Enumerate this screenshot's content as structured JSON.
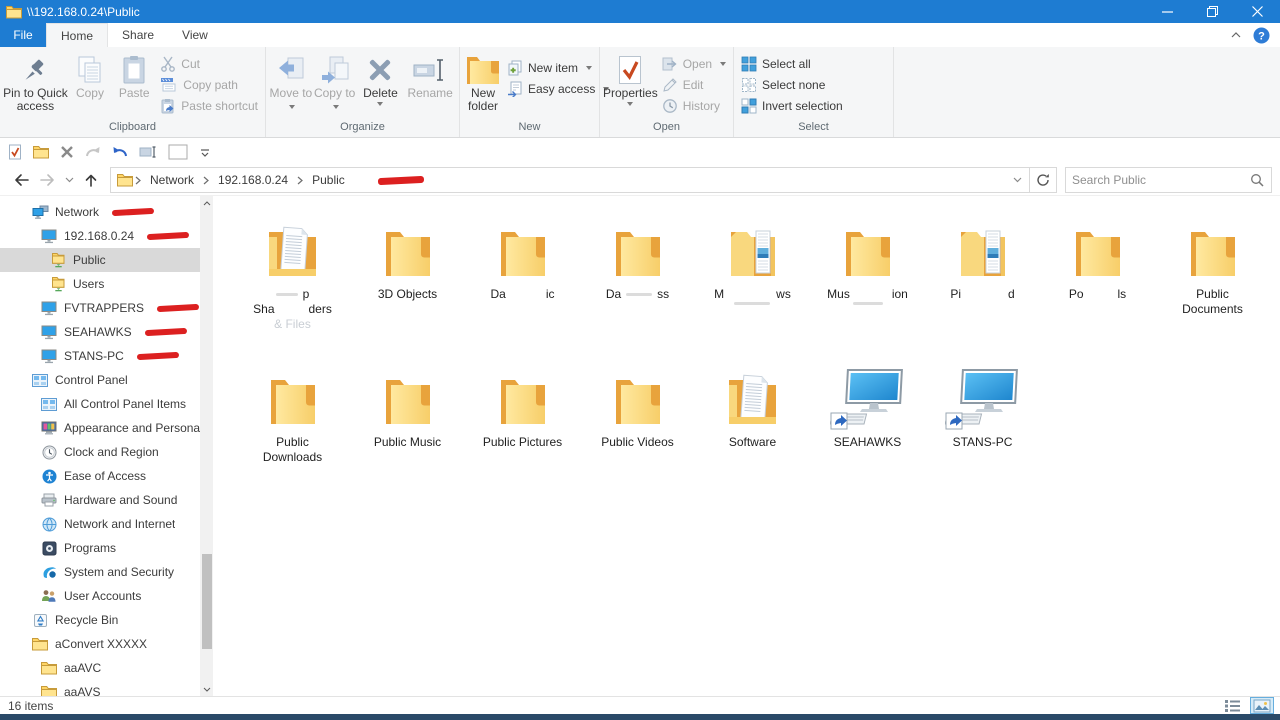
{
  "window": {
    "title": "\\\\192.168.0.24\\Public"
  },
  "tabs": {
    "file": "File",
    "home": "Home",
    "share": "Share",
    "view": "View"
  },
  "ribbon": {
    "clipboard": {
      "group": "Clipboard",
      "pin": "Pin to Quick access",
      "copy": "Copy",
      "paste": "Paste",
      "cut": "Cut",
      "copy_path": "Copy path",
      "paste_shortcut": "Paste shortcut"
    },
    "organize": {
      "group": "Organize",
      "move_to": "Move to",
      "copy_to": "Copy to",
      "delete": "Delete",
      "rename": "Rename"
    },
    "new": {
      "group": "New",
      "new_folder": "New folder",
      "new_item": "New item",
      "easy_access": "Easy access"
    },
    "open": {
      "group": "Open",
      "properties": "Properties",
      "open": "Open",
      "edit": "Edit",
      "history": "History"
    },
    "select": {
      "group": "Select",
      "select_all": "Select all",
      "select_none": "Select none",
      "invert": "Invert selection"
    }
  },
  "qat": {
    "items": [
      {
        "name": "properties",
        "icon": "qat-props"
      },
      {
        "name": "new-folder",
        "icon": "folder-sm"
      },
      {
        "name": "delete",
        "icon": "qat-x"
      },
      {
        "name": "redo",
        "icon": "qat-redo"
      },
      {
        "name": "undo",
        "icon": "qat-undo"
      },
      {
        "name": "rename",
        "icon": "qat-rename"
      },
      {
        "name": "blank",
        "icon": "qat-box"
      },
      {
        "name": "customize",
        "icon": "qat-more"
      }
    ]
  },
  "address": {
    "crumbs": [
      "Network",
      "192.168.0.24",
      "Public"
    ],
    "search_placeholder": "Search Public"
  },
  "sidebar": {
    "items": [
      {
        "label": "Network",
        "icon": "network",
        "indent": 0,
        "scribble": true
      },
      {
        "label": "192.168.0.24",
        "icon": "monitor",
        "indent": 1,
        "scribble": true
      },
      {
        "label": "Public",
        "icon": "sharedfolder",
        "indent": 2,
        "selected": true
      },
      {
        "label": "Users",
        "icon": "sharedfolder",
        "indent": 2
      },
      {
        "label": "FVTRAPPERS",
        "icon": "monitor",
        "indent": 1,
        "scribble": true
      },
      {
        "label": "SEAHAWKS",
        "icon": "monitor",
        "indent": 1,
        "scribble": true
      },
      {
        "label": "STANS-PC",
        "icon": "monitor",
        "indent": 1,
        "scribble": true
      },
      {
        "label": "Control Panel",
        "icon": "controlpanel",
        "indent": 0
      },
      {
        "label": "All Control Panel Items",
        "icon": "controlpanel",
        "indent": 1
      },
      {
        "label": "Appearance and Personalization",
        "icon": "appearance",
        "indent": 1
      },
      {
        "label": "Clock and Region",
        "icon": "clock",
        "indent": 1
      },
      {
        "label": "Ease of Access",
        "icon": "ease",
        "indent": 1
      },
      {
        "label": "Hardware and Sound",
        "icon": "hardware",
        "indent": 1
      },
      {
        "label": "Network and Internet",
        "icon": "netinternet",
        "indent": 1
      },
      {
        "label": "Programs",
        "icon": "programs",
        "indent": 1
      },
      {
        "label": "System and Security",
        "icon": "security",
        "indent": 1
      },
      {
        "label": "User Accounts",
        "icon": "users",
        "indent": 1
      },
      {
        "label": "Recycle Bin",
        "icon": "recycle",
        "indent": 0
      },
      {
        "label": "aConvert XXXXX",
        "icon": "folder",
        "indent": 0
      },
      {
        "label": "aaAVC",
        "icon": "folder",
        "indent": 1
      },
      {
        "label": "aaAVS",
        "icon": "folder",
        "indent": 1
      }
    ]
  },
  "files": {
    "items": [
      {
        "name": "shared-folders",
        "icon": "folder-doc",
        "lines": [
          [
            {
              "smudge": 22
            },
            {
              "gap": 5
            },
            {
              "t": "p"
            }
          ],
          [
            {
              "t": "Sha"
            },
            {
              "gap": 34
            },
            {
              "t": "ders"
            }
          ],
          [
            {
              "t": "& Files",
              "faint": true
            }
          ]
        ]
      },
      {
        "name": "3d-objects",
        "icon": "folder",
        "lines": [
          [
            {
              "t": "3D Objects"
            }
          ]
        ]
      },
      {
        "name": "redacted-da-ic",
        "icon": "folder",
        "lines": [
          [
            {
              "t": "Da"
            },
            {
              "gap": 40
            },
            {
              "t": "ic"
            }
          ]
        ]
      },
      {
        "name": "redacted-da-ss",
        "icon": "folder",
        "lines": [
          [
            {
              "t": "Da"
            },
            {
              "gap": 5
            },
            {
              "smudge": 26
            },
            {
              "gap": 5
            },
            {
              "t": "ss"
            }
          ]
        ]
      },
      {
        "name": "redacted-m-ws",
        "icon": "folder-files",
        "lines": [
          [
            {
              "t": "M"
            },
            {
              "gap": 52
            },
            {
              "t": "ws"
            }
          ],
          [
            {
              "smudge": 36
            }
          ]
        ]
      },
      {
        "name": "redacted-mus-ion",
        "icon": "folder",
        "lines": [
          [
            {
              "t": "Mus"
            },
            {
              "gap": 42
            },
            {
              "t": "ion"
            }
          ],
          [
            {
              "smudge": 30
            }
          ]
        ]
      },
      {
        "name": "redacted-pi-d",
        "icon": "folder-files",
        "lines": [
          [
            {
              "t": "Pi"
            },
            {
              "gap": 47
            },
            {
              "t": "d"
            }
          ]
        ]
      },
      {
        "name": "redacted-po-ls",
        "icon": "folder",
        "lines": [
          [
            {
              "t": "Po"
            },
            {
              "gap": 34
            },
            {
              "t": "ls"
            }
          ]
        ]
      },
      {
        "name": "public-documents",
        "icon": "folder",
        "lines": [
          [
            {
              "t": "Public"
            }
          ],
          [
            {
              "t": "Documents"
            }
          ]
        ]
      },
      {
        "name": "public-downloads",
        "icon": "folder",
        "lines": [
          [
            {
              "t": "Public"
            }
          ],
          [
            {
              "t": "Downloads"
            }
          ]
        ]
      },
      {
        "name": "public-music",
        "icon": "folder",
        "lines": [
          [
            {
              "t": "Public Music"
            }
          ]
        ]
      },
      {
        "name": "public-pictures",
        "icon": "folder",
        "lines": [
          [
            {
              "t": "Public Pictures"
            }
          ]
        ]
      },
      {
        "name": "public-videos",
        "icon": "folder",
        "lines": [
          [
            {
              "t": "Public Videos"
            }
          ]
        ]
      },
      {
        "name": "software",
        "icon": "folder-doc",
        "lines": [
          [
            {
              "t": "Software"
            }
          ]
        ]
      },
      {
        "name": "seahawks",
        "icon": "computer",
        "lines": [
          [
            {
              "t": "SEAHAWKS"
            }
          ]
        ]
      },
      {
        "name": "stans-pc",
        "icon": "computer",
        "lines": [
          [
            {
              "t": "STANS-PC"
            }
          ]
        ]
      }
    ]
  },
  "status": {
    "count": "16 items"
  },
  "colors": {
    "titlebar": "#1E7CD2",
    "scribble": "#DC2020",
    "selection": "#D9D9D9",
    "taskbar_edge": "#2A4A68"
  }
}
